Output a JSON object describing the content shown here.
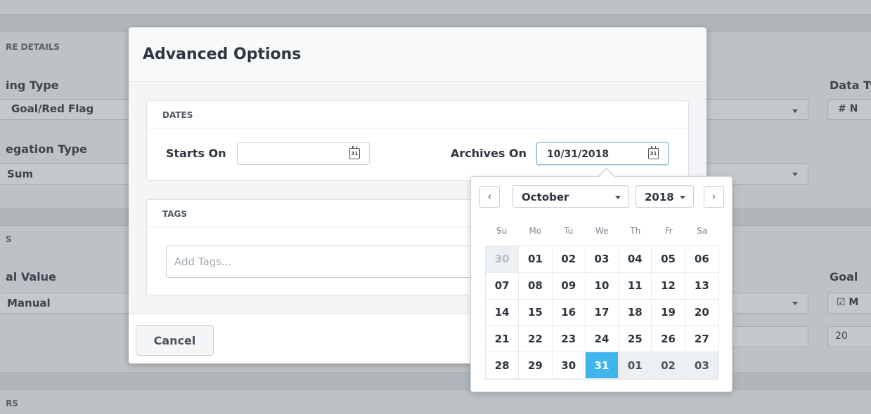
{
  "background": {
    "sections": [
      "RE DETAILS",
      "S",
      "RS"
    ],
    "labels": {
      "left_type": "ing Type",
      "left_aggregation": "egation Type",
      "left_value": "al Value",
      "right_data_type": "Data Ty",
      "right_goal": "Goal"
    },
    "values": {
      "goal_red_flag": "Goal/Red Flag",
      "sum": "Sum",
      "manual": "Manual",
      "data_type_value": "# N",
      "goal_value": "☑ M",
      "goal_number": "20"
    }
  },
  "modal": {
    "title": "Advanced Options",
    "dates": {
      "header": "DATES",
      "starts_on_label": "Starts On",
      "starts_on_value": "",
      "archives_on_label": "Archives On",
      "archives_on_value": "10/31/2018",
      "calendar_icon_text": "31"
    },
    "tags": {
      "header": "TAGS",
      "placeholder": "Add Tags..."
    },
    "cancel_label": "Cancel"
  },
  "datepicker": {
    "prev_icon": "chevron-left-icon",
    "next_icon": "chevron-right-icon",
    "prev_glyph": "‹",
    "next_glyph": "›",
    "month": "October",
    "year": "2018",
    "weekdays": [
      "Su",
      "Mo",
      "Tu",
      "We",
      "Th",
      "Fr",
      "Sa"
    ],
    "days": [
      {
        "label": "30",
        "state": "outside-muted"
      },
      {
        "label": "01"
      },
      {
        "label": "02"
      },
      {
        "label": "03"
      },
      {
        "label": "04"
      },
      {
        "label": "05"
      },
      {
        "label": "06"
      },
      {
        "label": "07"
      },
      {
        "label": "08"
      },
      {
        "label": "09"
      },
      {
        "label": "10"
      },
      {
        "label": "11"
      },
      {
        "label": "12"
      },
      {
        "label": "13"
      },
      {
        "label": "14"
      },
      {
        "label": "15"
      },
      {
        "label": "16"
      },
      {
        "label": "17"
      },
      {
        "label": "18"
      },
      {
        "label": "19"
      },
      {
        "label": "20"
      },
      {
        "label": "21"
      },
      {
        "label": "22"
      },
      {
        "label": "23"
      },
      {
        "label": "24"
      },
      {
        "label": "25"
      },
      {
        "label": "26"
      },
      {
        "label": "27"
      },
      {
        "label": "28"
      },
      {
        "label": "29"
      },
      {
        "label": "30"
      },
      {
        "label": "31",
        "state": "selected"
      },
      {
        "label": "01",
        "state": "outside"
      },
      {
        "label": "02",
        "state": "outside"
      },
      {
        "label": "03",
        "state": "outside"
      }
    ],
    "selected_color": "#3fb5ec"
  }
}
